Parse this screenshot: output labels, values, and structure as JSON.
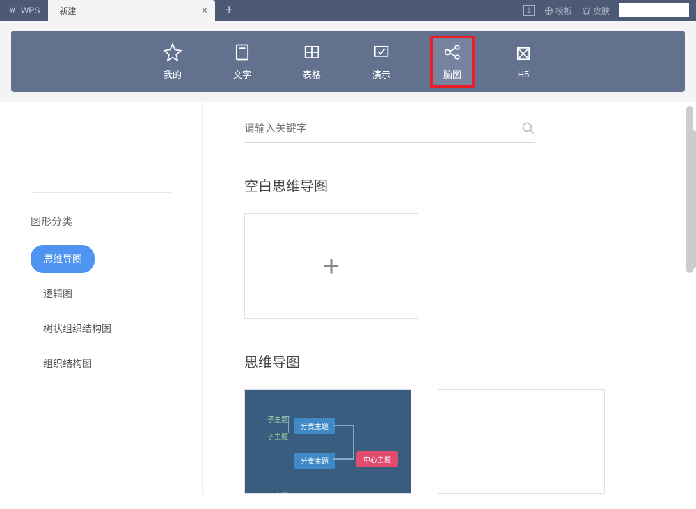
{
  "titlebar": {
    "app_name": "WPS",
    "tab_label": "新建",
    "badge": "1",
    "template_label": "模板",
    "skin_label": "皮肤"
  },
  "ribbon": {
    "items": [
      {
        "label": "我的"
      },
      {
        "label": "文字"
      },
      {
        "label": "表格"
      },
      {
        "label": "演示"
      },
      {
        "label": "脑图"
      },
      {
        "label": "H5"
      }
    ]
  },
  "sidebar": {
    "title": "图形分类",
    "categories": [
      {
        "label": "思维导图"
      },
      {
        "label": "逻辑图"
      },
      {
        "label": "树状组织结构图"
      },
      {
        "label": "组织结构图"
      }
    ]
  },
  "content": {
    "search_placeholder": "请输入关键字",
    "section_blank_title": "空白思维导图",
    "section_templates_title": "思维导图",
    "preview": {
      "center": "中心主题",
      "branch": "分支主题",
      "leaf1": "子主题",
      "leaf2": "子主题",
      "leaf3": "子主题"
    }
  }
}
